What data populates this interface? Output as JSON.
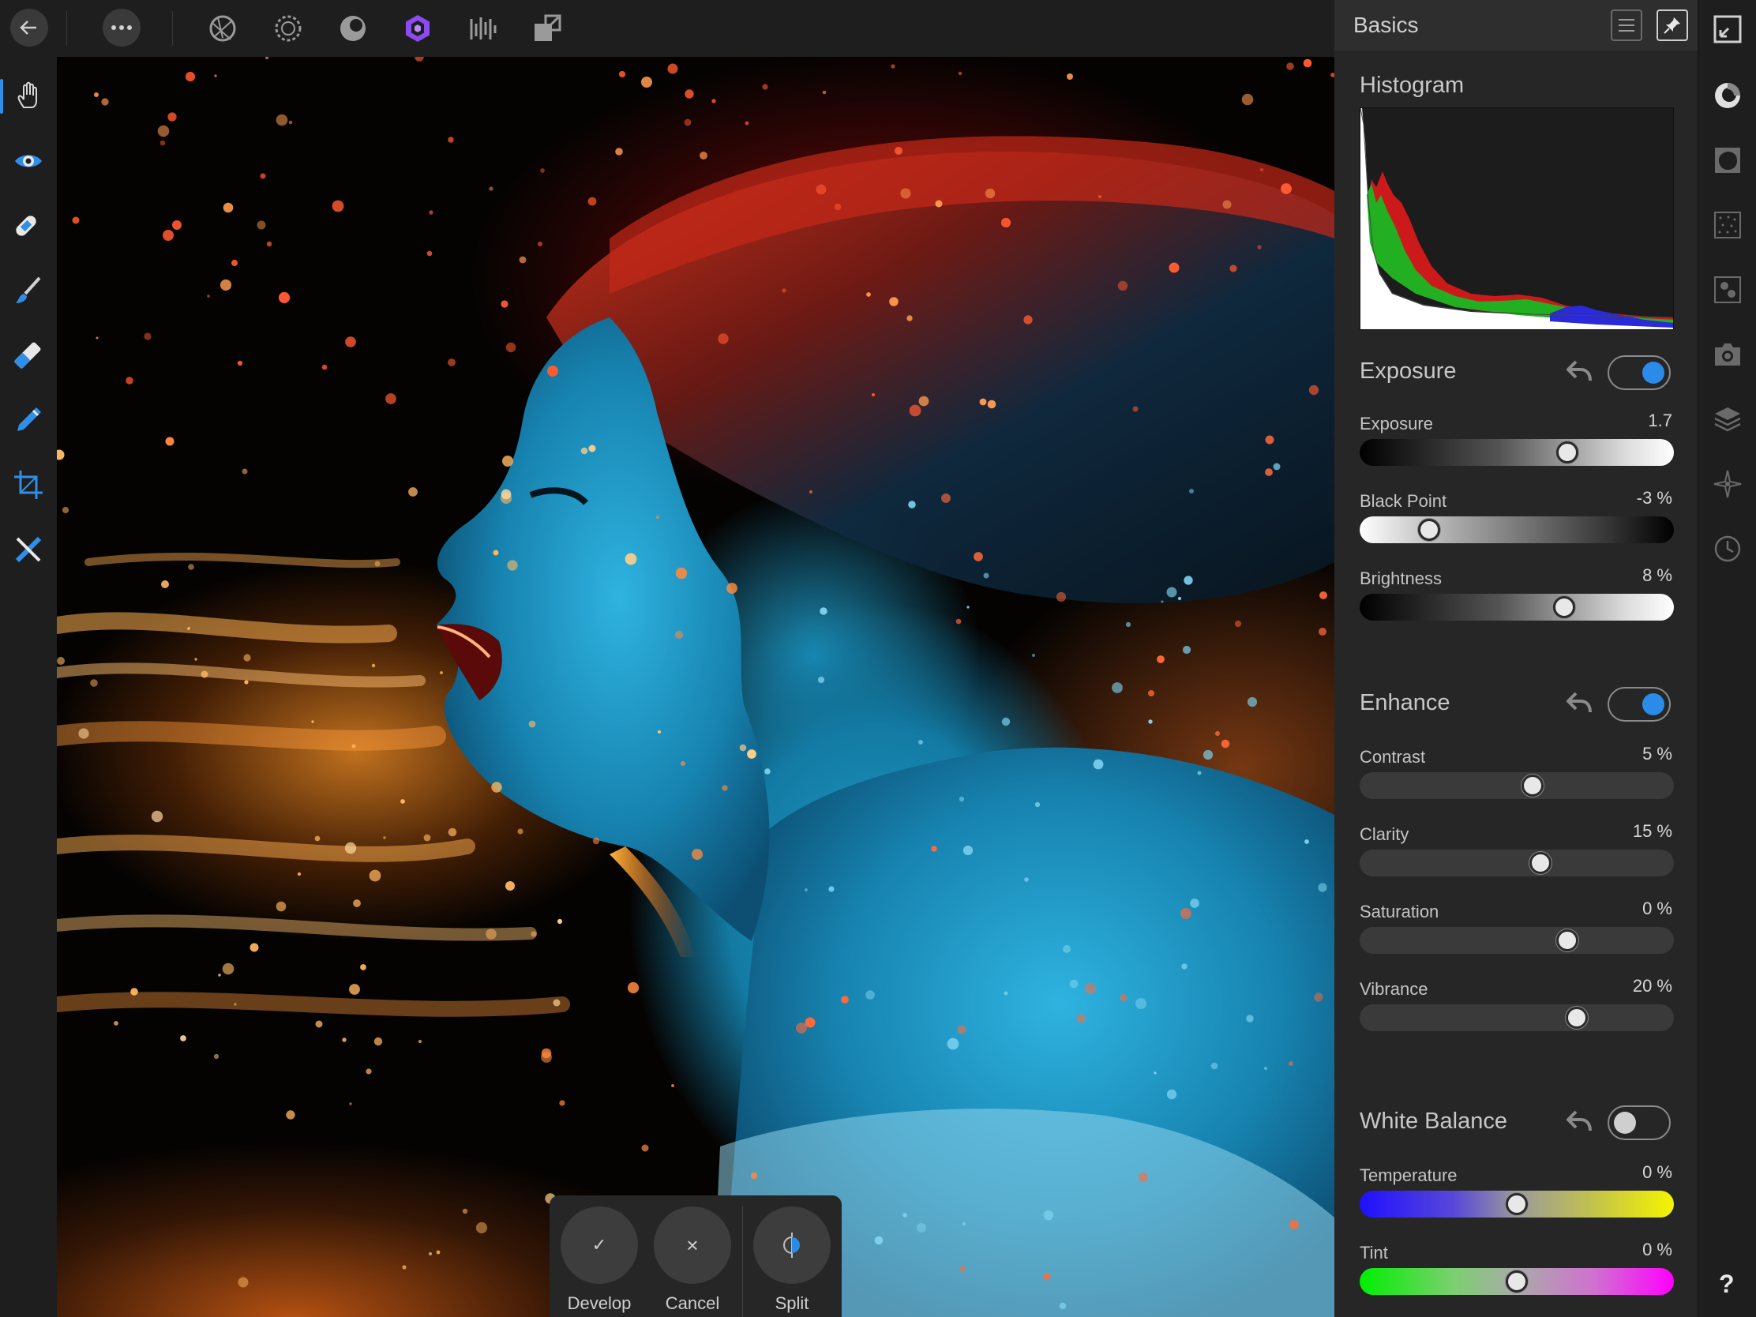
{
  "topbar": {
    "back_icon": "arrow-left-icon",
    "more_icon": "ellipsis-icon",
    "personas": [
      {
        "name": "photo-persona-icon",
        "active": false
      },
      {
        "name": "liquify-persona-icon",
        "active": false
      },
      {
        "name": "develop-persona-icon",
        "active": false
      },
      {
        "name": "tone-mapping-persona-icon",
        "active": true
      },
      {
        "name": "export-persona-icon",
        "active": false
      },
      {
        "name": "share-icon",
        "active": false
      }
    ],
    "accent": "#8a4cf0"
  },
  "left_tools": [
    {
      "name": "hand-tool-icon",
      "active": true
    },
    {
      "name": "view-tool-icon",
      "active": false
    },
    {
      "name": "blemish-removal-tool-icon",
      "active": false
    },
    {
      "name": "brush-tool-icon",
      "active": false
    },
    {
      "name": "overlay-gradient-tool-icon",
      "active": false
    },
    {
      "name": "overlay-paint-tool-icon",
      "active": false
    },
    {
      "name": "crop-tool-icon",
      "active": false
    },
    {
      "name": "red-eye-tool-icon",
      "active": false
    }
  ],
  "panel": {
    "title": "Basics",
    "histogram": {
      "title": "Histogram"
    },
    "exposure": {
      "title": "Exposure",
      "enabled": true,
      "sliders": [
        {
          "label": "Exposure",
          "value": "1.7",
          "position": 0.66
        },
        {
          "label": "Black Point",
          "value": "-3 %",
          "position": 0.22
        },
        {
          "label": "Brightness",
          "value": "8 %",
          "position": 0.65
        }
      ]
    },
    "enhance": {
      "title": "Enhance",
      "enabled": true,
      "sliders": [
        {
          "label": "Contrast",
          "value": "5 %",
          "position": 0.55
        },
        {
          "label": "Clarity",
          "value": "15 %",
          "position": 0.575
        },
        {
          "label": "Saturation",
          "value": "0 %",
          "position": 0.66
        },
        {
          "label": "Vibrance",
          "value": "20 %",
          "position": 0.69
        }
      ]
    },
    "white_balance": {
      "title": "White Balance",
      "enabled": false,
      "sliders": [
        {
          "label": "Temperature",
          "value": "0 %",
          "position": 0.5
        },
        {
          "label": "Tint",
          "value": "0 %",
          "position": 0.5
        }
      ]
    },
    "toggle_on_color": "#2a8be8"
  },
  "studio": {
    "icons": [
      "fit-screen-icon",
      "basics-studio-icon",
      "vignette-studio-icon",
      "noise-studio-icon",
      "detail-studio-icon",
      "lens-studio-icon",
      "overlays-studio-icon",
      "navigator-studio-icon",
      "history-studio-icon"
    ],
    "help": "?"
  },
  "actions": {
    "develop": "Develop",
    "cancel": "Cancel",
    "split": "Split",
    "develop_icon": "✓",
    "cancel_icon": "×"
  }
}
